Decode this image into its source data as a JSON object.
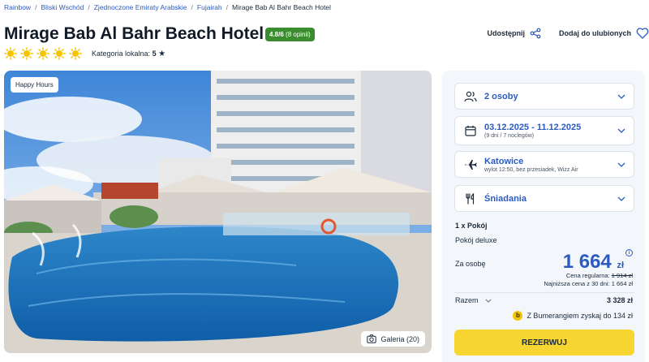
{
  "breadcrumb": {
    "items": [
      "Rainbow",
      "Bliski Wschód",
      "Zjednoczone Emiraty Arabskie",
      "Fujairah"
    ],
    "current": "Mirage Bab Al Bahr Beach Hotel",
    "separator": "/"
  },
  "hotel": {
    "name": "Mirage Bab Al Bahr Beach Hotel",
    "rating": "4.8/6",
    "rating_count": "(8 opinii)",
    "suns": 5,
    "category_label": "Kategoria lokalna:",
    "category_value": "5",
    "category_star": "★"
  },
  "actions": {
    "share": "Udostępnij",
    "favorite": "Dodaj do ulubionych"
  },
  "photo": {
    "badge": "Happy Hours",
    "gallery": "Galeria (20)"
  },
  "booking": {
    "persons": "2 osoby",
    "dates": "03.12.2025 - 11.12.2025",
    "dates_sub": "(9 dni / 7 noclegów)",
    "departure": "Katowice",
    "departure_sub": "wylot 12:50, bez przesiadek, Wizz Air",
    "board": "Śniadania",
    "room_count": "1 x Pokój",
    "room_type": "Pokój deluxe",
    "per_person_label": "Za osobę",
    "price": "1 664",
    "price_currency": "zł",
    "info": "i",
    "regular_label": "Cena regularna:",
    "regular_price": "1 914 zł",
    "lowest_label": "Najniższa cena z 30 dni: 1 664 zł",
    "total_label": "Razem",
    "total_value": "3 328 zł",
    "bumerang_logo": "b",
    "bumerang": "Z Bumerangiem zyskaj do 134 zł",
    "reserve": "REZERWUJ"
  },
  "colors": {
    "accent": "#2c5bbf",
    "rating": "#3a8d2f",
    "cta": "#f8d632",
    "sun": "#f5c400"
  }
}
